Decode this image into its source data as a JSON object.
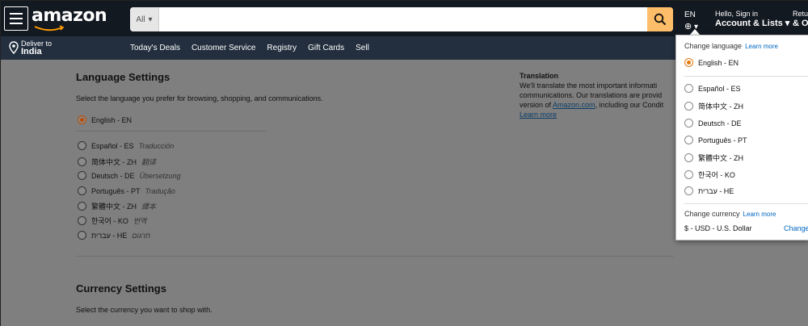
{
  "header": {
    "logo_text": "amazon",
    "search_category": "All",
    "search_value": "",
    "lang_code": "EN",
    "account_greeting": "Hello, Sign in",
    "account_label": "Account & Lists",
    "returns_top": "Retu",
    "returns_bottom": "& O"
  },
  "subnav": {
    "deliver_to": "Deliver to",
    "deliver_location": "India",
    "links": [
      "Today's Deals",
      "Customer Service",
      "Registry",
      "Gift Cards",
      "Sell"
    ]
  },
  "language_settings": {
    "title": "Language Settings",
    "description": "Select the language you prefer for browsing, shopping, and communications.",
    "selected": "English - EN",
    "options": [
      {
        "label": "Español - ES",
        "hint": "Traducción"
      },
      {
        "label": "简体中文 - ZH",
        "hint": "翻译"
      },
      {
        "label": "Deutsch - DE",
        "hint": "Übersetzung"
      },
      {
        "label": "Português - PT",
        "hint": "Tradução"
      },
      {
        "label": "繁體中文 - ZH",
        "hint": "譯本"
      },
      {
        "label": "한국어 - KO",
        "hint": "번역"
      },
      {
        "label": "עברית - HE",
        "hint": "תרגום"
      }
    ]
  },
  "translation": {
    "title": "Translation",
    "line1": "We'll translate the most important informati",
    "line2": "communications. Our translations are provid",
    "line3_prefix": "version of ",
    "line3_link": "Amazon.com",
    "line3_suffix": ", including our Condit",
    "learn_more": "Learn more"
  },
  "currency_settings": {
    "title": "Currency Settings",
    "description": "Select the currency you want to shop with."
  },
  "flyout": {
    "change_language": "Change language",
    "learn_more": "Learn more",
    "selected": "English - EN",
    "options": [
      "Español - ES",
      "简体中文 - ZH",
      "Deutsch - DE",
      "Português - PT",
      "繁體中文 - ZH",
      "한국어 - KO",
      "עברית - HE"
    ],
    "change_currency": "Change currency",
    "currency_learn_more": "Learn more",
    "currency_value": "$ - USD - U.S. Dollar",
    "change_link": "Change"
  },
  "colors": {
    "nav_bg": "#131921",
    "subnav_bg": "#232f3e",
    "search_button": "#febd69",
    "radio_selected": "#e47911",
    "link": "#0066c0"
  }
}
